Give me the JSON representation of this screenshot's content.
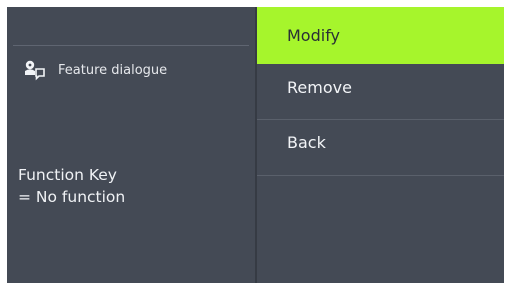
{
  "left": {
    "feature_icon": "speech-bubble-person-icon",
    "feature_label": "Feature dialogue",
    "function_key_line1": "Function Key",
    "function_key_line2": "= No function"
  },
  "menu": {
    "items": [
      {
        "label": "Modify",
        "selected": true
      },
      {
        "label": "Remove",
        "selected": false
      },
      {
        "label": "Back",
        "selected": false
      }
    ]
  },
  "colors": {
    "background": "#444a55",
    "selected": "#a6f52c",
    "text": "#f2f4f7"
  }
}
